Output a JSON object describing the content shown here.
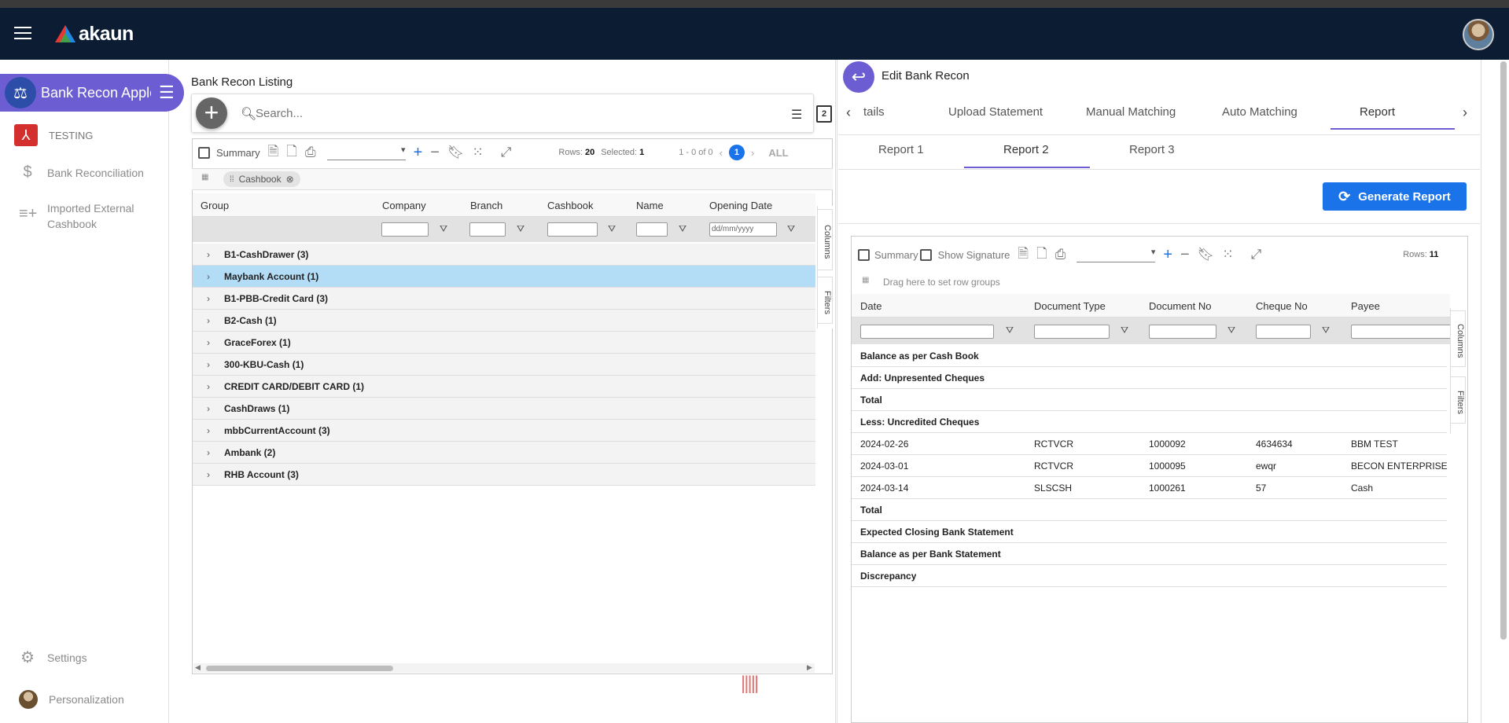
{
  "app": {
    "name": "akaun"
  },
  "sidebar": {
    "app_chip_label": "Bank Recon Apple",
    "items": [
      {
        "label": "TESTING",
        "icon": "acrobat-icon"
      },
      {
        "label": "Bank Reconciliation",
        "icon": "dollar-icon"
      },
      {
        "label": "Imported External Cashbook",
        "icon": "playlist-add-icon"
      }
    ],
    "bottom": [
      {
        "label": "Settings",
        "icon": "gear-icon"
      },
      {
        "label": "Personalization",
        "icon": "avatar-icon"
      }
    ]
  },
  "listing": {
    "title": "Bank Recon Listing",
    "search_placeholder": "Search...",
    "toolbar": {
      "summary_label": "Summary",
      "rows_label": "Rows:",
      "rows_value": "20",
      "selected_label": "Selected:",
      "selected_value": "1",
      "range": "1 - 0 of 0",
      "page": "1",
      "all_label": "ALL"
    },
    "group_chip": "Cashbook",
    "columns": [
      "Group",
      "Company",
      "Branch",
      "Cashbook",
      "Name",
      "Opening Date"
    ],
    "date_placeholder": "dd/mm/yyyy",
    "groups": [
      "B1-CashDrawer (3)",
      "Maybank Account (1)",
      "B1-PBB-Credit Card (3)",
      "B2-Cash (1)",
      "GraceForex (1)",
      "300-KBU-Cash (1)",
      "CREDIT CARD/DEBIT CARD (1)",
      "CashDraws (1)",
      "mbbCurrentAccount (3)",
      "Ambank (2)",
      "RHB Account (3)"
    ],
    "selected_index": 1,
    "side_tabs": [
      "Columns",
      "Filters"
    ]
  },
  "edit": {
    "title": "Edit Bank Recon",
    "tabs": [
      "tails",
      "Upload Statement",
      "Manual Matching",
      "Auto Matching",
      "Report"
    ],
    "active_tab": "Report",
    "subtabs": [
      "Report 1",
      "Report 2",
      "Report 3"
    ],
    "active_subtab": "Report 2",
    "generate_label": "Generate Report",
    "toolbar": {
      "summary_label": "Summary",
      "signature_label": "Show Signature",
      "rows_label": "Rows:",
      "rows_value": "11"
    },
    "row_group_hint": "Drag here to set row groups",
    "columns": [
      "Date",
      "Document Type",
      "Document No",
      "Cheque No",
      "Payee"
    ],
    "rows": [
      {
        "date": "Balance as per Cash Book",
        "bold": true
      },
      {
        "date": "Add: Unpresented Cheques",
        "bold": true
      },
      {
        "date": "Total",
        "bold": true
      },
      {
        "date": "Less: Uncredited Cheques",
        "bold": true
      },
      {
        "date": "2024-02-26",
        "doc_type": "RCTVCR",
        "doc_no": "1000092",
        "cheque": "4634634",
        "payee": "BBM TEST"
      },
      {
        "date": "2024-03-01",
        "doc_type": "RCTVCR",
        "doc_no": "1000095",
        "cheque": "ewqr",
        "payee": "BECON ENTERPRISE SDN"
      },
      {
        "date": "2024-03-14",
        "doc_type": "SLSCSH",
        "doc_no": "1000261",
        "cheque": "57",
        "payee": "Cash"
      },
      {
        "date": "Total",
        "bold": true
      },
      {
        "date": "Expected Closing Bank Statement",
        "bold": true
      },
      {
        "date": "Balance as per Bank Statement",
        "bold": true
      },
      {
        "date": "Discrepancy",
        "bold": true
      }
    ],
    "side_tabs": [
      "Columns",
      "Filters"
    ]
  }
}
